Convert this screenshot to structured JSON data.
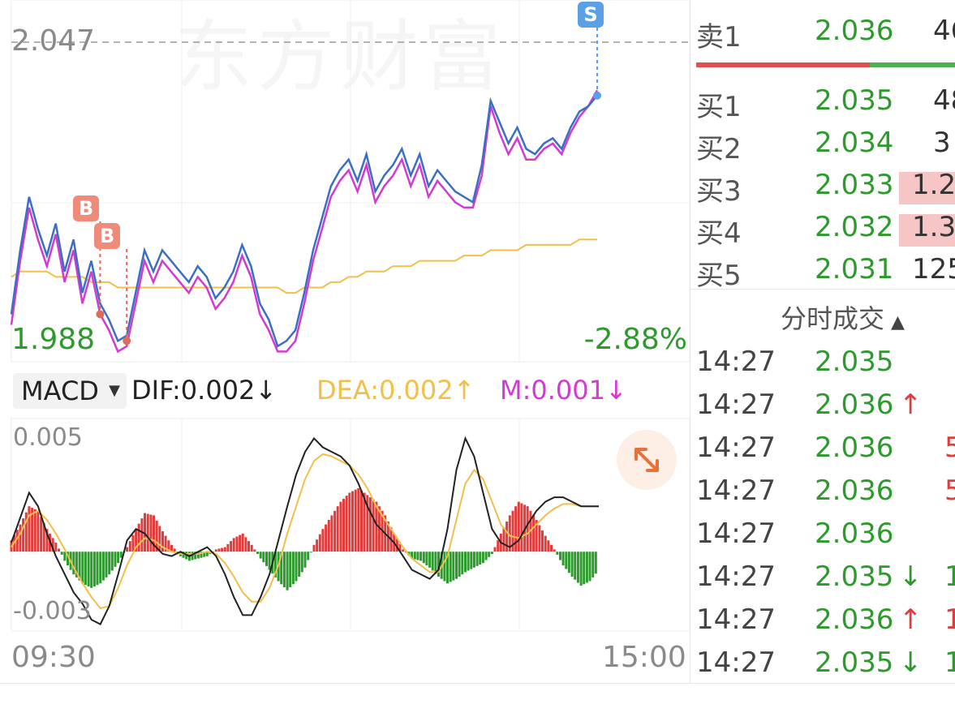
{
  "watermark": "东方财富",
  "chart_data": [
    {
      "type": "line",
      "title": "",
      "y_top_label": "2.047",
      "y_bottom_label": "1.988",
      "change_label": "-2.88%",
      "ylim": [
        1.988,
        2.047
      ],
      "x_labels": [
        "09:30",
        "15:00"
      ],
      "series": [
        {
          "values": [
            1.996,
            2.008,
            2.018,
            2.012,
            2.007,
            2.013,
            2.004,
            2.01,
            2.0,
            2.006,
            1.998,
            1.995,
            1.991,
            1.992,
            2.0,
            2.008,
            2.004,
            2.008,
            2.006,
            2.004,
            2.002,
            2.005,
            2.003,
            1.999,
            2.001,
            2.004,
            2.009,
            2.005,
            1.998,
            1.995,
            1.99,
            1.991,
            1.993,
            2.0,
            2.008,
            2.014,
            2.02,
            2.023,
            2.025,
            2.021,
            2.026,
            2.019,
            2.022,
            2.024,
            2.027,
            2.022,
            2.026,
            2.02,
            2.023,
            2.021,
            2.019,
            2.018,
            2.017,
            2.024,
            2.036,
            2.032,
            2.028,
            2.031,
            2.027,
            2.026,
            2.028,
            2.029,
            2.027,
            2.031,
            2.034,
            2.035,
            2.037
          ]
        },
        {
          "values": [
            1.994,
            2.006,
            2.016,
            2.01,
            2.005,
            2.011,
            2.002,
            2.008,
            1.998,
            2.004,
            1.996,
            1.993,
            1.989,
            1.99,
            1.998,
            2.006,
            2.002,
            2.006,
            2.004,
            2.002,
            2.0,
            2.003,
            2.001,
            1.997,
            1.999,
            2.002,
            2.007,
            2.003,
            1.996,
            1.993,
            1.989,
            1.989,
            1.991,
            1.998,
            2.006,
            2.012,
            2.018,
            2.021,
            2.023,
            2.019,
            2.024,
            2.017,
            2.02,
            2.022,
            2.025,
            2.02,
            2.024,
            2.018,
            2.021,
            2.019,
            2.017,
            2.016,
            2.016,
            2.022,
            2.035,
            2.03,
            2.026,
            2.029,
            2.025,
            2.025,
            2.027,
            2.028,
            2.026,
            2.03,
            2.033,
            2.035,
            2.038
          ]
        },
        {
          "values": [
            2.003,
            2.004,
            2.004,
            2.004,
            2.004,
            2.003,
            2.003,
            2.003,
            2.003,
            2.002,
            2.002,
            2.002,
            2.001,
            2.001,
            2.001,
            2.001,
            2.001,
            2.001,
            2.001,
            2.001,
            2.001,
            2.001,
            2.001,
            2.001,
            2.001,
            2.001,
            2.001,
            2.001,
            2.001,
            2.001,
            2.001,
            2.0,
            2.0,
            2.001,
            2.001,
            2.001,
            2.002,
            2.002,
            2.003,
            2.003,
            2.004,
            2.004,
            2.004,
            2.005,
            2.005,
            2.005,
            2.006,
            2.006,
            2.006,
            2.006,
            2.006,
            2.007,
            2.007,
            2.007,
            2.008,
            2.008,
            2.008,
            2.008,
            2.009,
            2.009,
            2.009,
            2.009,
            2.009,
            2.009,
            2.01,
            2.01,
            2.01
          ]
        }
      ],
      "colors": {
        "price": "#3a6fc4",
        "price2": "#d23ad2",
        "avg": "#f0c04a",
        "ref_line": "#9a9a9a"
      },
      "markers": [
        {
          "label": "B",
          "x_index": 10,
          "y": 1.996
        },
        {
          "label": "B",
          "x_index": 13,
          "y": 1.991
        },
        {
          "label": "S",
          "x_index": 66,
          "y": 2.037
        }
      ]
    },
    {
      "type": "bar",
      "title": "MACD",
      "ylim": [
        -0.0035,
        0.0058
      ],
      "y_top_label": "0.005",
      "y_bottom_label": "-0.003",
      "histogram": [
        0.0005,
        0.0012,
        0.002,
        0.0018,
        0.001,
        0.0004,
        -0.0004,
        -0.001,
        -0.0014,
        -0.0016,
        -0.0014,
        -0.001,
        -0.0005,
        0.0002,
        0.001,
        0.0017,
        0.0016,
        0.0009,
        0.0003,
        -0.0002,
        -0.0004,
        -0.0003,
        -0.0002,
        0.0001,
        0.0002,
        0.0006,
        0.0008,
        0.0003,
        -0.0003,
        -0.0008,
        -0.0013,
        -0.0017,
        -0.0013,
        -0.0007,
        0.0003,
        0.001,
        0.0016,
        0.0022,
        0.0026,
        0.0028,
        0.0025,
        0.0022,
        0.0016,
        0.0008,
        0.0001,
        -0.0003,
        -0.0004,
        -0.0007,
        -0.0011,
        -0.0014,
        -0.0012,
        -0.0009,
        -0.0007,
        -0.0005,
        -0.0001,
        0.0008,
        0.0016,
        0.0022,
        0.002,
        0.0014,
        0.0007,
        0.0001,
        -0.0006,
        -0.0011,
        -0.0015,
        -0.0013,
        -0.0008
      ],
      "dif": [
        0.0004,
        0.0015,
        0.0026,
        0.002,
        0.0008,
        -0.0002,
        -0.001,
        -0.0018,
        -0.0023,
        -0.003,
        -0.0032,
        -0.0024,
        -0.001,
        0.0005,
        0.001,
        0.0008,
        0.0003,
        -0.0001,
        -0.0002,
        0.0,
        -0.0002,
        0.0,
        0.0002,
        -0.0002,
        -0.001,
        -0.002,
        -0.0028,
        -0.0028,
        -0.002,
        -0.001,
        0.0005,
        0.002,
        0.0034,
        0.0044,
        0.005,
        0.0046,
        0.0044,
        0.0042,
        0.0038,
        0.003,
        0.002,
        0.0012,
        0.0008,
        0.0004,
        -0.0002,
        -0.0008,
        -0.001,
        -0.0012,
        -0.0008,
        0.001,
        0.0036,
        0.005,
        0.0042,
        0.0026,
        0.001,
        0.0004,
        0.0002,
        0.0005,
        0.0012,
        0.0018,
        0.0022,
        0.0024,
        0.0024,
        0.0022,
        0.002,
        0.002,
        0.002
      ],
      "dea": [
        0.0002,
        0.0008,
        0.0016,
        0.0018,
        0.0014,
        0.0008,
        0.0001,
        -0.0007,
        -0.0014,
        -0.002,
        -0.0025,
        -0.0024,
        -0.0016,
        -0.0006,
        0.0002,
        0.0006,
        0.0005,
        0.0002,
        0.0,
        -0.0001,
        -0.0001,
        -0.0001,
        0.0,
        -0.0001,
        -0.0005,
        -0.0011,
        -0.0018,
        -0.0022,
        -0.0022,
        -0.0016,
        -0.0006,
        0.0008,
        0.002,
        0.0032,
        0.004,
        0.0043,
        0.0042,
        0.004,
        0.0038,
        0.0034,
        0.0028,
        0.002,
        0.0014,
        0.0008,
        0.0002,
        -0.0003,
        -0.0006,
        -0.0009,
        -0.0009,
        -0.0002,
        0.0014,
        0.003,
        0.0036,
        0.0032,
        0.0022,
        0.0012,
        0.0007,
        0.0006,
        0.0008,
        0.0012,
        0.0016,
        0.0019,
        0.0021,
        0.0021,
        0.002,
        0.002,
        0.002
      ],
      "colors": {
        "pos": "#e03c3c",
        "neg": "#2e9a2e",
        "dif": "#222222",
        "dea": "#f0c04a"
      }
    }
  ],
  "indicator": {
    "name": "MACD",
    "dif_label": "DIF:0.002",
    "dif_arrow": "↓",
    "dea_label": "DEA:0.002",
    "dea_arrow": "↑",
    "m_label": "M:0.001",
    "m_arrow": "↓"
  },
  "order_book": {
    "sells": [
      {
        "label": "卖1",
        "price": "2.036",
        "vol": "46"
      }
    ],
    "buys": [
      {
        "label": "买1",
        "price": "2.035",
        "vol": "48"
      },
      {
        "label": "买2",
        "price": "2.034",
        "vol": "3"
      },
      {
        "label": "买3",
        "price": "2.033",
        "vol": "1.2"
      },
      {
        "label": "买4",
        "price": "2.032",
        "vol": "1.3"
      },
      {
        "label": "买5",
        "price": "2.031",
        "vol": "125"
      }
    ]
  },
  "trades": {
    "header": "分时成交",
    "rows": [
      {
        "time": "14:27",
        "price": "2.035",
        "arrow": "",
        "vol": ""
      },
      {
        "time": "14:27",
        "price": "2.036",
        "arrow": "↑",
        "vol": ""
      },
      {
        "time": "14:27",
        "price": "2.036",
        "arrow": "",
        "vol": "5"
      },
      {
        "time": "14:27",
        "price": "2.036",
        "arrow": "",
        "vol": "5"
      },
      {
        "time": "14:27",
        "price": "2.036",
        "arrow": "",
        "vol": ""
      },
      {
        "time": "14:27",
        "price": "2.035",
        "arrow": "↓",
        "vol": "1"
      },
      {
        "time": "14:27",
        "price": "2.036",
        "arrow": "↑",
        "vol": "1"
      },
      {
        "time": "14:27",
        "price": "2.035",
        "arrow": "↓",
        "vol": "1"
      }
    ]
  }
}
